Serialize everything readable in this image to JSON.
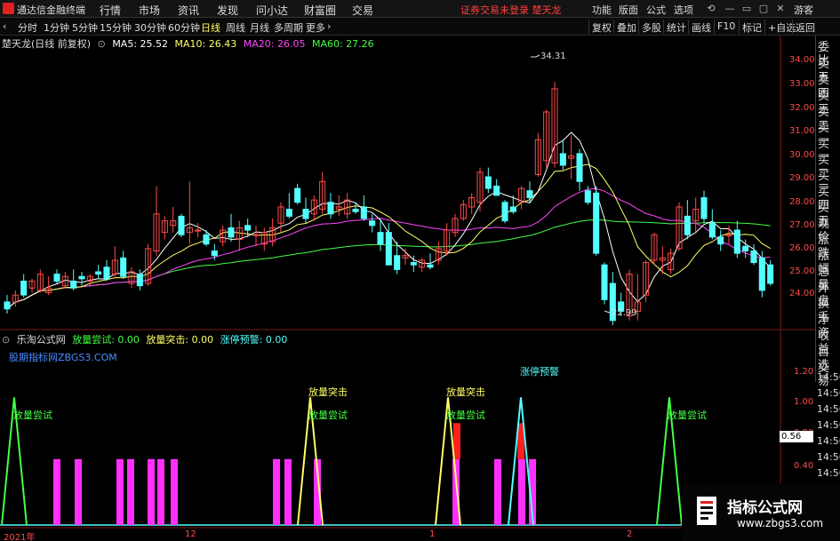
{
  "menubar": {
    "app_title": "通达信金融终端",
    "items": [
      "行情",
      "市场",
      "资讯",
      "发现",
      "问小达",
      "财富圈",
      "交易"
    ],
    "warning": "证券交易未登录  楚天龙",
    "right_items": [
      "功能",
      "版面",
      "公式",
      "选项"
    ],
    "guest": "游客"
  },
  "toolbar": {
    "periods": [
      "分时",
      "1分钟",
      "5分钟",
      "15分钟",
      "30分钟",
      "60分钟",
      "日线",
      "周线",
      "月线",
      "多周期",
      "更多"
    ],
    "active_period": "日线",
    "right_items": [
      "复权",
      "叠加",
      "多股",
      "统计",
      "画线",
      "F10",
      "标记",
      "+自选",
      "返回"
    ]
  },
  "main_legend": {
    "stock": "楚天龙(日线 前复权)",
    "ma5": "MA5: 25.52",
    "ma10": "MA10: 26.43",
    "ma20": "MA20: 26.05",
    "ma60": "MA60: 27.26"
  },
  "colors": {
    "up": "#ff4a4a",
    "down": "#54ffff",
    "ma5": "#ffffff",
    "ma10": "#ffff66",
    "ma20": "#ff44ff",
    "ma60": "#44ff44",
    "accent": "#ffff66"
  },
  "sub_legend": {
    "name": "乐淘公式网",
    "v1": "放量尝试: 0.00",
    "v2": "放量突击: 0.00",
    "v3": "涨停预警: 0.00",
    "link": "股期指标网ZBGS3.COM"
  },
  "side_panel": {
    "items": [
      "委比",
      "卖五",
      "卖四",
      "卖三",
      "卖二",
      "卖一",
      "买一",
      "买二",
      "买三",
      "买四",
      "买五",
      "现价",
      "涨跌",
      "涨幅",
      "总量",
      "外盘",
      "换手",
      "净资",
      "收益"
    ],
    "extra": [
      "自选",
      "交易"
    ],
    "times": [
      "14:56",
      "14:56",
      "14:56",
      "14:56",
      "14:56",
      "14:56",
      "14:56",
      "14:56"
    ]
  },
  "price_axis": [
    "34.00",
    "33.00",
    "32.00",
    "31.00",
    "30.00",
    "29.00",
    "28.00",
    "27.00",
    "26.00",
    "25.00",
    "24.00"
  ],
  "indicator_axis": [
    "1.20",
    "1.00",
    "0.80",
    "0.56",
    "0.40"
  ],
  "cursor_value": "0.56",
  "time_axis": [
    "2021年",
    "12",
    "1",
    "2"
  ],
  "annotations": {
    "high": "34.31",
    "low": "22.99",
    "signal1": "放量尝试",
    "signal2": "放量突击",
    "signal3": "涨停预警"
  },
  "brand": {
    "title": "指标公式网",
    "url": "www.zbgs3.com"
  },
  "chart_data": {
    "type": "candlestick",
    "title": "楚天龙(日线 前复权)",
    "ylim": [
      22.5,
      35
    ],
    "candles": [
      [
        24.0,
        24.3,
        23.5,
        23.7
      ],
      [
        24.0,
        24.5,
        23.8,
        24.3
      ],
      [
        24.9,
        25.2,
        24.2,
        24.3
      ],
      [
        24.6,
        25.0,
        24.4,
        24.9
      ],
      [
        24.5,
        25.4,
        24.4,
        25.2
      ],
      [
        24.4,
        25.1,
        24.3,
        24.6
      ],
      [
        25.2,
        25.4,
        24.8,
        24.9
      ],
      [
        24.7,
        25.3,
        24.6,
        25.1
      ],
      [
        24.9,
        25.4,
        24.5,
        24.6
      ],
      [
        25.1,
        25.3,
        24.7,
        25.0
      ],
      [
        24.9,
        25.2,
        24.7,
        25.1
      ],
      [
        25.3,
        25.6,
        25.0,
        25.2
      ],
      [
        25.5,
        25.8,
        24.9,
        25.0
      ],
      [
        25.2,
        26.4,
        25.0,
        25.8
      ],
      [
        25.9,
        26.2,
        25.0,
        25.1
      ],
      [
        24.8,
        25.5,
        24.6,
        25.3
      ],
      [
        25.2,
        25.4,
        24.5,
        24.7
      ],
      [
        24.8,
        26.5,
        24.7,
        26.3
      ],
      [
        26.2,
        29.0,
        26.0,
        27.8
      ],
      [
        27.0,
        27.7,
        26.7,
        27.5
      ],
      [
        27.3,
        28.1,
        27.0,
        27.5
      ],
      [
        27.7,
        27.8,
        26.8,
        26.9
      ],
      [
        27.0,
        29.2,
        26.5,
        27.2
      ],
      [
        27.1,
        27.4,
        26.8,
        27.1
      ],
      [
        26.9,
        27.1,
        26.4,
        26.5
      ],
      [
        26.2,
        26.5,
        25.8,
        26.0
      ],
      [
        26.6,
        27.3,
        26.4,
        27.1
      ],
      [
        27.2,
        27.8,
        26.6,
        26.8
      ],
      [
        26.7,
        27.5,
        26.2,
        27.2
      ],
      [
        27.3,
        27.6,
        26.8,
        27.1
      ],
      [
        26.9,
        27.3,
        26.4,
        26.9
      ],
      [
        26.5,
        27.2,
        26.2,
        27.0
      ],
      [
        26.6,
        27.6,
        26.4,
        27.2
      ],
      [
        27.4,
        28.3,
        27.0,
        28.1
      ],
      [
        28.0,
        28.7,
        27.6,
        27.7
      ],
      [
        28.9,
        29.1,
        28.2,
        28.3
      ],
      [
        28.0,
        28.5,
        27.4,
        27.6
      ],
      [
        27.8,
        28.6,
        27.5,
        28.4
      ],
      [
        28.0,
        29.6,
        27.8,
        29.2
      ],
      [
        28.3,
        28.7,
        27.6,
        27.8
      ],
      [
        28.0,
        28.6,
        27.7,
        28.1
      ],
      [
        27.8,
        28.7,
        27.6,
        28.4
      ],
      [
        28.0,
        28.3,
        27.8,
        27.9
      ],
      [
        28.1,
        28.6,
        27.5,
        27.6
      ],
      [
        27.5,
        27.8,
        27.0,
        27.3
      ],
      [
        27.0,
        27.6,
        26.2,
        26.5
      ],
      [
        27.0,
        27.4,
        25.6,
        25.6
      ],
      [
        26.0,
        26.6,
        25.2,
        25.4
      ],
      [
        25.9,
        26.3,
        25.6,
        26.0
      ],
      [
        25.7,
        26.0,
        25.3,
        25.6
      ],
      [
        25.5,
        25.9,
        25.3,
        25.8
      ],
      [
        25.6,
        26.1,
        25.4,
        25.5
      ],
      [
        25.8,
        26.6,
        25.6,
        26.3
      ],
      [
        26.2,
        27.4,
        26.0,
        27.1
      ],
      [
        27.0,
        27.8,
        26.8,
        27.6
      ],
      [
        27.6,
        28.4,
        27.5,
        28.2
      ],
      [
        28.1,
        28.7,
        27.8,
        28.5
      ],
      [
        28.3,
        29.8,
        27.9,
        29.6
      ],
      [
        29.4,
        29.8,
        28.7,
        28.9
      ],
      [
        29.0,
        29.3,
        28.6,
        28.6
      ],
      [
        28.3,
        28.4,
        27.4,
        27.5
      ],
      [
        28.1,
        28.6,
        27.8,
        27.9
      ],
      [
        28.3,
        29.0,
        28.0,
        28.9
      ],
      [
        28.8,
        29.2,
        28.3,
        28.5
      ],
      [
        29.5,
        31.3,
        29.4,
        31.0
      ],
      [
        30.1,
        32.3,
        29.8,
        32.2
      ],
      [
        30.0,
        33.5,
        29.8,
        33.2
      ],
      [
        30.4,
        31.0,
        29.7,
        29.9
      ],
      [
        30.2,
        31.2,
        29.3,
        30.3
      ],
      [
        30.4,
        30.6,
        28.8,
        29.2
      ],
      [
        28.8,
        29.0,
        28.2,
        28.3
      ],
      [
        28.7,
        29.0,
        26.0,
        26.1
      ],
      [
        25.6,
        25.7,
        23.9,
        24.1
      ],
      [
        24.8,
        25.3,
        23.0,
        23.2
      ],
      [
        24.0,
        24.4,
        23.4,
        23.6
      ],
      [
        23.4,
        25.4,
        23.2,
        25.2
      ],
      [
        23.6,
        25.2,
        23.2,
        24.0
      ],
      [
        24.3,
        25.8,
        24.0,
        25.7
      ],
      [
        25.8,
        27.0,
        25.6,
        26.9
      ],
      [
        25.8,
        26.4,
        25.2,
        25.9
      ],
      [
        25.4,
        26.3,
        25.2,
        26.1
      ],
      [
        26.3,
        28.3,
        26.2,
        28.1
      ],
      [
        27.7,
        28.4,
        26.7,
        26.9
      ],
      [
        27.5,
        28.5,
        27.0,
        28.0
      ],
      [
        28.5,
        28.8,
        27.4,
        27.6
      ],
      [
        27.4,
        28.0,
        26.7,
        26.8
      ],
      [
        26.8,
        27.1,
        26.2,
        26.5
      ],
      [
        26.9,
        27.3,
        26.5,
        26.9
      ],
      [
        27.1,
        27.5,
        25.9,
        26.1
      ],
      [
        26.4,
        26.7,
        25.9,
        26.2
      ],
      [
        26.2,
        26.5,
        25.6,
        25.7
      ],
      [
        25.9,
        26.2,
        24.2,
        24.5
      ],
      [
        25.6,
        25.8,
        24.7,
        24.8
      ]
    ],
    "indicator": {
      "ylim": [
        0,
        1.3
      ],
      "series": [
        {
          "name": "放量尝试",
          "color": "#44ff44"
        },
        {
          "name": "放量突击",
          "color": "#ffff66"
        },
        {
          "name": "涨停预警",
          "color": "#54ffff"
        }
      ]
    }
  }
}
